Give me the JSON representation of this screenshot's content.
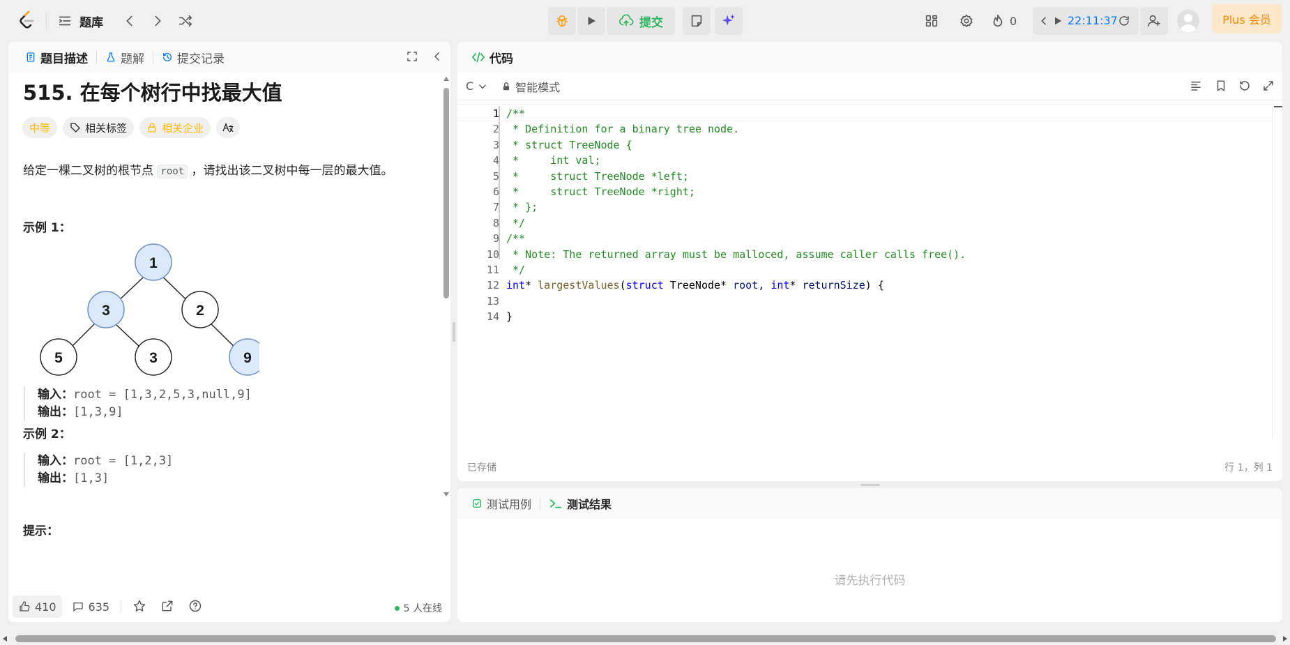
{
  "topbar": {
    "nav_title": "题库",
    "submit_label": "提交",
    "streak_count": "0",
    "timer": "22:11:37",
    "plus_label": "Plus 会员"
  },
  "left": {
    "tabs": [
      {
        "label": "题目描述"
      },
      {
        "label": "题解"
      },
      {
        "label": "提交记录"
      }
    ],
    "title": "515. 在每个树行中找最大值",
    "tags": {
      "difficulty": "中等",
      "related_tags": "相关标签",
      "companies": "相关企业"
    },
    "desc_before": "给定一棵二叉树的根节点 ",
    "desc_code": "root",
    "desc_after": " ，请找出该二叉树中每一层的最大值。",
    "example1": {
      "heading": "示例 1：",
      "input_label": "输入：",
      "input_value": "root = [1,3,2,5,3,null,9]",
      "output_label": "输出：",
      "output_value": "[1,3,9]"
    },
    "tree_nodes": [
      "1",
      "3",
      "2",
      "5",
      "3",
      "9"
    ],
    "example2": {
      "heading": "示例 2：",
      "input_label": "输入：",
      "input_value": "root = [1,2,3]",
      "output_label": "输出：",
      "output_value": "[1,3]"
    },
    "hint_heading": "提示：",
    "footer": {
      "likes": "410",
      "comments": "635",
      "online": "5 人在线"
    }
  },
  "editor": {
    "tab_label": "代码",
    "language": "C",
    "mode": "智能模式",
    "status_saved": "已存储",
    "cursor": "行 1，列 1",
    "lines": [
      "/**",
      " * Definition for a binary tree node.",
      " * struct TreeNode {",
      " *     int val;",
      " *     struct TreeNode *left;",
      " *     struct TreeNode *right;",
      " * };",
      " */",
      "/**",
      " * Note: The returned array must be malloced, assume caller calls free().",
      " */",
      "int* largestValues(struct TreeNode* root, int* returnSize) {",
      "",
      "}"
    ],
    "line_numbers": [
      "1",
      "2",
      "3",
      "4",
      "5",
      "6",
      "7",
      "8",
      "9",
      "10",
      "11",
      "12",
      "13",
      "14"
    ],
    "sig_parts": [
      "int",
      "* ",
      "largestValues",
      "(",
      "struct",
      " TreeNode* ",
      "root",
      ", ",
      "int",
      "* ",
      "returnSize",
      ") {"
    ]
  },
  "results": {
    "tabs": [
      {
        "label": "测试用例"
      },
      {
        "label": "测试结果"
      }
    ],
    "placeholder": "请先执行代码"
  },
  "colors": {
    "accent_green": "#2db55d",
    "blue_link": "#007aff",
    "difficulty": "#ffb800",
    "node_fill": "#dbe9fb"
  }
}
